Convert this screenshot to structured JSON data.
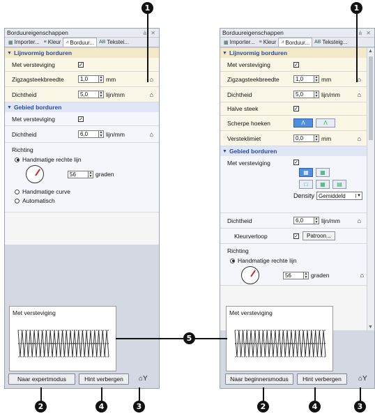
{
  "left": {
    "title": "Borduureigenschappen",
    "title_controls": "ȧ ✕",
    "tabs": [
      "Importer...",
      "Kleur",
      "Borduur...",
      "Tekstei..."
    ],
    "sec1_title": "Lijnvormig borduren",
    "rows1": [
      {
        "label": "Met versteviging",
        "check": "✓"
      },
      {
        "label": "Zigzagsteekbreedte",
        "value": "1,0",
        "unit": "mm"
      },
      {
        "label": "Dichtheid",
        "value": "5,0",
        "unit": "lijn/mm"
      }
    ],
    "sec2_title": "Gebied borduren",
    "rows2": [
      {
        "label": "Met versteviging",
        "check": "✓"
      },
      {
        "label": "Dichtheid",
        "value": "6,0",
        "unit": "lijn/mm"
      }
    ],
    "richting": "Richting",
    "radio_handmatig_lijn": "Handmatige rechte lijn",
    "angle_value": "56",
    "angle_unit": "graden",
    "radio_curve": "Handmatige curve",
    "radio_auto": "Automatisch",
    "preview_title": "Met versteviging",
    "btn_mode": "Naar expertmodus",
    "btn_hint": "Hint verbergen"
  },
  "right": {
    "title": "Borduureigenschappen",
    "title_controls": "ȧ ✕",
    "tabs": [
      "Importer...",
      "Kleur",
      "Borduur...",
      "Teksteig..."
    ],
    "sec1_title": "Lijnvormig borduren",
    "rows1": [
      {
        "label": "Met versteviging",
        "check": "✓"
      },
      {
        "label": "Zigzagsteekbreedte",
        "value": "1,0",
        "unit": "mm"
      },
      {
        "label": "Dichtheid",
        "value": "5,0",
        "unit": "lijn/mm"
      },
      {
        "label": "Halve steek",
        "check": "✓"
      },
      {
        "label": "Scherpe hoeken"
      },
      {
        "label": "Versteklimiet",
        "value": "0,0",
        "unit": "mm"
      }
    ],
    "sec2_title": "Gebied borduren",
    "met_versteviging": "Met versteviging",
    "check": "✓",
    "density_label": "Density",
    "density_value": "Gemiddeld",
    "dichtheid_label": "Dichtheid",
    "dichtheid_value": "6,0",
    "dichtheid_unit": "lijn/mm",
    "kleurverloop_label": "Kleurverloop",
    "patroon_button": "Patroon...",
    "richting": "Richting",
    "radio_handmatig_lijn": "Handmatige rechte lijn",
    "angle_value": "56",
    "angle_unit": "graden",
    "preview_title": "Met versteviging",
    "btn_mode": "Naar beginnersmodus",
    "btn_hint": "Hint verbergen"
  },
  "callouts": {
    "c1": "1",
    "c2": "2",
    "c3": "3",
    "c4": "4",
    "c5": "5"
  },
  "icons": {
    "house": "house-icon",
    "binoculars": "binoculars-icon"
  }
}
